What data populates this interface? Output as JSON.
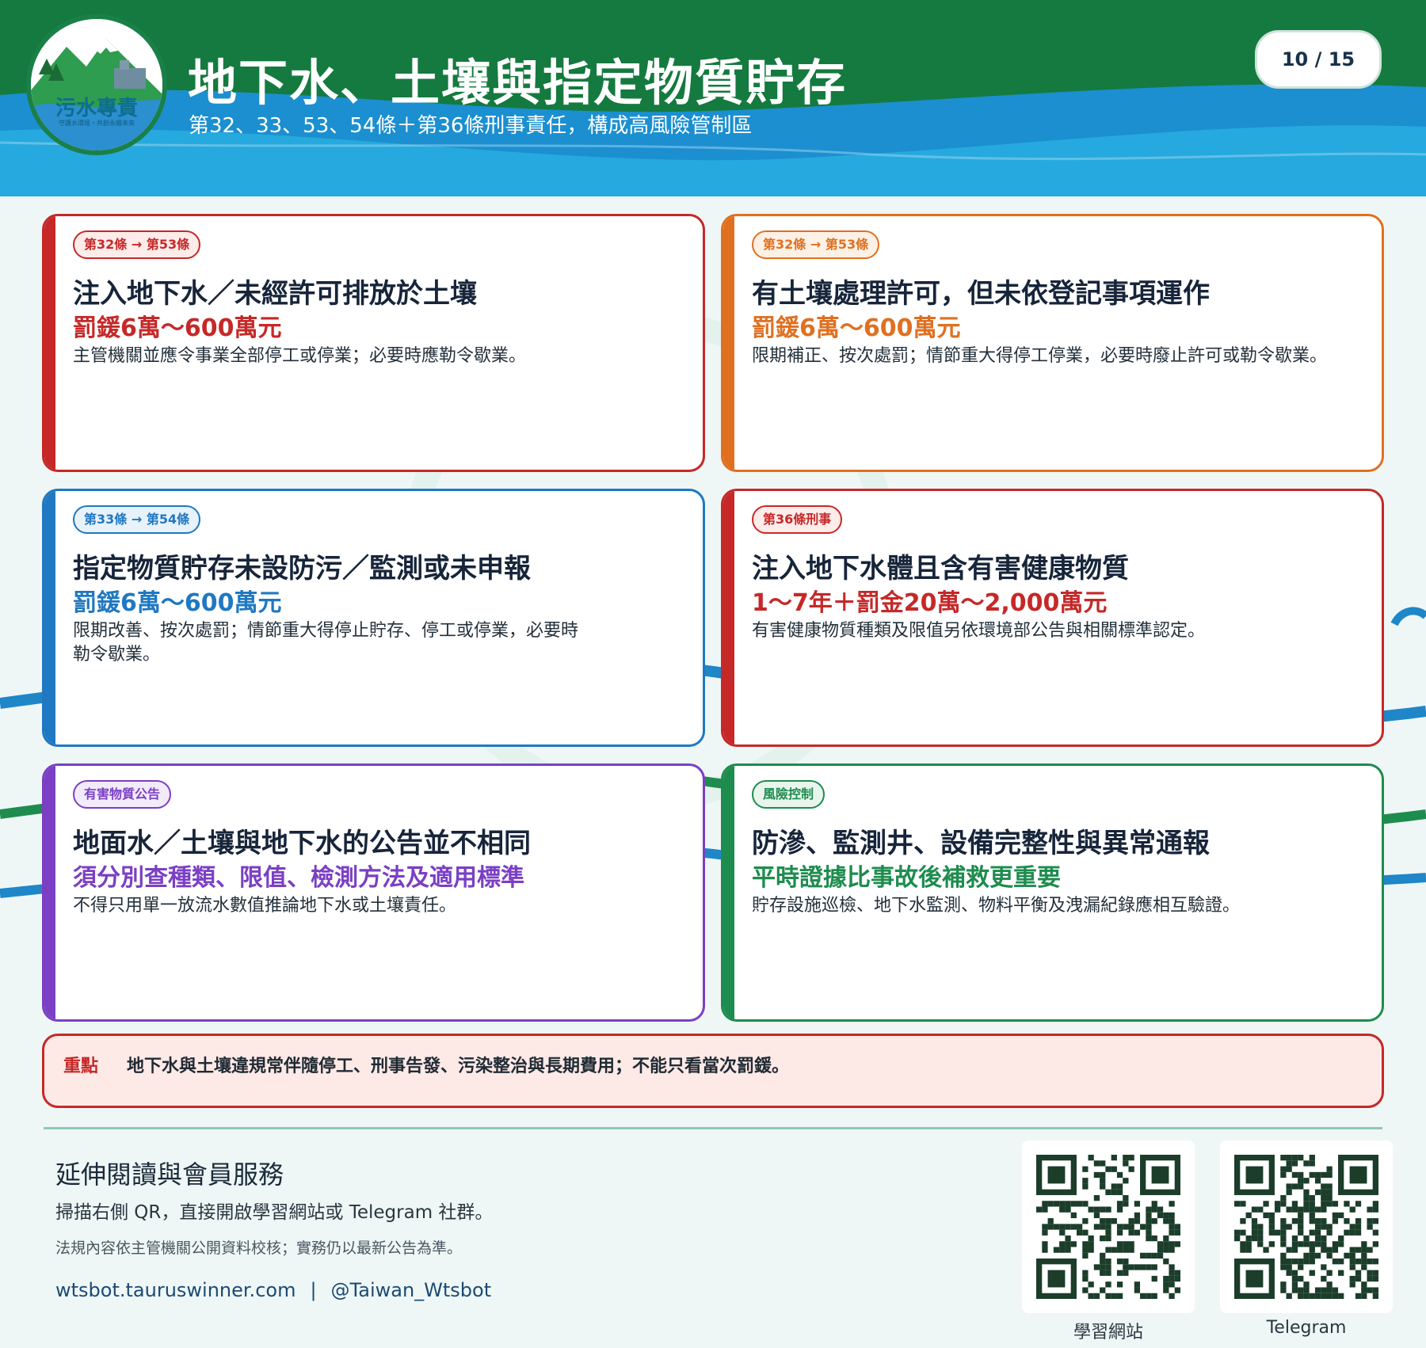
{
  "header": {
    "logo_text": "污水專責",
    "logo_sub": "守護水環境・共創永續未來",
    "title": "地下水、土壤與指定物質貯存",
    "subtitle": "第32、33、53、54條＋第36條刑事責任，構成高風險管制區",
    "page_indicator": "10 / 15"
  },
  "cards": [
    {
      "tag": "第32條 → 第53條",
      "title": "注入地下水／未經許可排放於土壤",
      "penalty": "罰鍰6萬～600萬元",
      "desc": "主管機關並應令事業全部停工或停業；必要時應勒令歇業。",
      "color": "#c62828"
    },
    {
      "tag": "第32條 → 第53條",
      "title": "有土壤處理許可，但未依登記事項運作",
      "penalty": "罰鍰6萬～600萬元",
      "desc": "限期補正、按次處罰；情節重大得停工停業，必要時廢止許可或勒令歇業。",
      "color": "#e07020"
    },
    {
      "tag": "第33條 → 第54條",
      "title": "指定物質貯存未設防污／監測或未申報",
      "penalty": "罰鍰6萬～600萬元",
      "desc": "限期改善、按次處罰；情節重大得停止貯存、停工或停業，必要時勒令歇業。",
      "color": "#1f78c1"
    },
    {
      "tag": "第36條刑事",
      "title": "注入地下水體且含有害健康物質",
      "penalty": "1～7年＋罰金20萬～2,000萬元",
      "desc": "有害健康物質種類及限值另依環境部公告與相關標準認定。",
      "color": "#c62828"
    },
    {
      "tag": "有害物質公告",
      "title": "地面水／土壤與地下水的公告並不相同",
      "penalty": "須分別查種類、限值、檢測方法及適用標準",
      "desc": "不得只用單一放流水數值推論地下水或土壤責任。",
      "color": "#7b3fc4"
    },
    {
      "tag": "風險控制",
      "title": "防滲、監測井、設備完整性與異常通報",
      "penalty": "平時證據比事故後補救更重要",
      "desc": "貯存設施巡檢、地下水監測、物料平衡及洩漏紀錄應相互驗證。",
      "color": "#1e8c4e"
    }
  ],
  "keypoint": {
    "label": "重點",
    "text": "地下水與土壤違規常伴隨停工、刑事告發、污染整治與長期費用；不能只看當次罰鍰。"
  },
  "footer": {
    "title": "延伸閱讀與會員服務",
    "desc": "掃描右側 QR，直接開啟學習網站或 Telegram 社群。",
    "note": "法規內容依主管機關公開資料校核；實務仍以最新公告為準。",
    "link_site": "wtsbot.tauruswinner.com",
    "link_sep": "|",
    "link_telegram": "@Taiwan_Wtsbot",
    "qr_site_label": "學習網站",
    "qr_telegram_label": "Telegram"
  },
  "colors": {
    "header_green": "#157a3f",
    "header_blue": "#1b8fd0",
    "header_light_blue": "#26a9de",
    "keypoint_red": "#c62828"
  }
}
